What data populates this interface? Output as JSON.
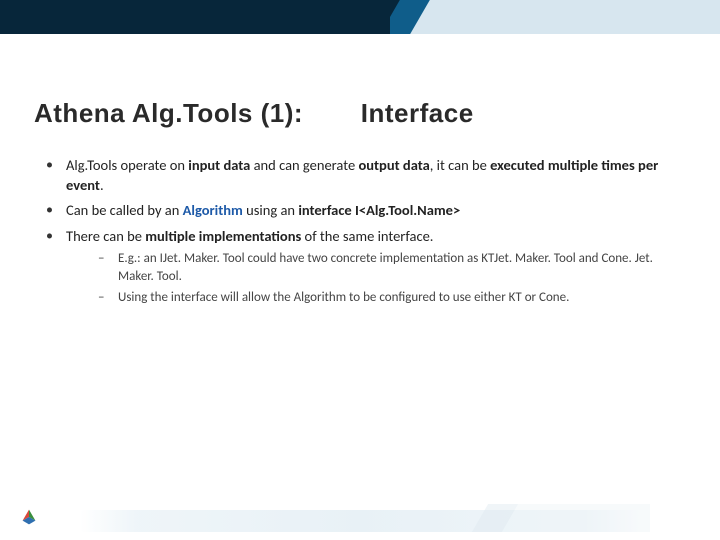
{
  "title": {
    "part1": "Athena Alg.Tools (1):",
    "part2": "Interface"
  },
  "bullets": [
    {
      "runs": [
        {
          "t": "Alg.Tools operate on "
        },
        {
          "t": "input data",
          "b": true
        },
        {
          "t": " and can generate "
        },
        {
          "t": "output data",
          "b": true
        },
        {
          "t": ", it can be "
        },
        {
          "t": "executed multiple times per event",
          "b": true
        },
        {
          "t": "."
        }
      ]
    },
    {
      "runs": [
        {
          "t": "Can be called by an "
        },
        {
          "t": "Algorithm",
          "link": true
        },
        {
          "t": " using an "
        },
        {
          "t": "interface",
          "b": true
        },
        {
          "t": " "
        },
        {
          "t": "I<Alg.Tool.Name>",
          "tmpl": true
        }
      ]
    },
    {
      "runs": [
        {
          "t": "There can be "
        },
        {
          "t": "multiple implementations",
          "b": true
        },
        {
          "t": " of the same interface."
        }
      ],
      "sub": [
        {
          "t": "E.g.: an IJet. Maker. Tool could have two concrete implementation as KTJet. Maker. Tool and Cone. Jet. Maker. Tool."
        },
        {
          "t": "Using the interface will allow the Algorithm to be configured to use either KT or Cone."
        }
      ]
    }
  ]
}
